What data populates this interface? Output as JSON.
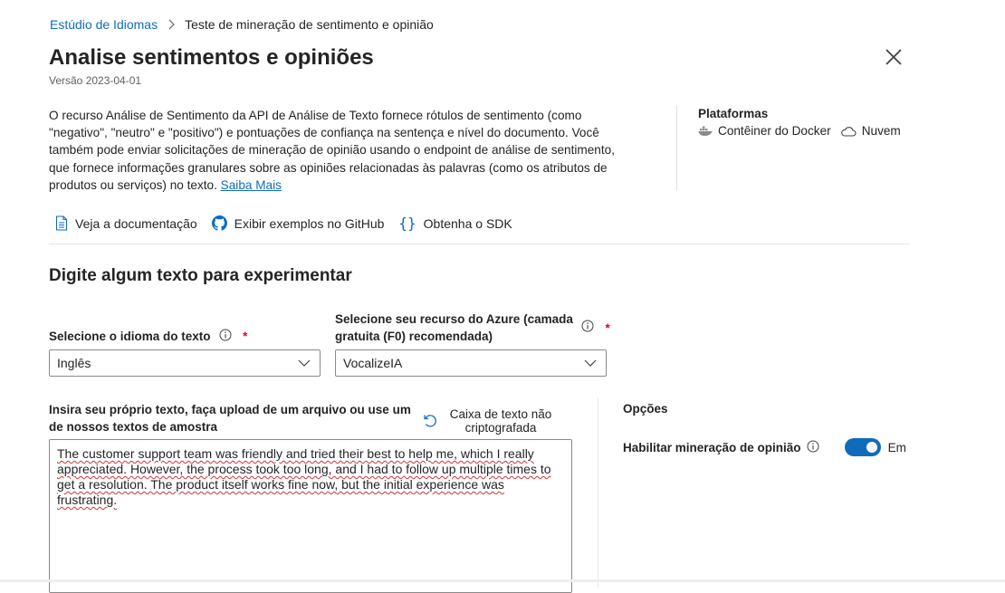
{
  "breadcrumb": {
    "root": "Estúdio de Idiomas",
    "current": "Teste de mineração de sentimento e opinião"
  },
  "header": {
    "title": "Analise sentimentos e opiniões",
    "version": "Versão 2023-04-01"
  },
  "description": {
    "text": "O recurso Análise de Sentimento da API de Análise de Texto fornece rótulos de sentimento (como \"negativo\", \"neutro\" e \"positivo\") e pontuações de confiança na sentença e nível do documento. Você também pode enviar solicitações de mineração de opinião usando o endpoint de análise de sentimento, que fornece informações granulares sobre as opiniões relacionadas às palavras (como os atributos de produtos ou serviços) no texto.",
    "learn_more": "Saiba Mais"
  },
  "platforms": {
    "title": "Plataformas",
    "docker": "Contêiner do Docker",
    "cloud": "Nuvem"
  },
  "links": {
    "docs": "Veja a documentação",
    "github": "Exibir exemplos no GitHub",
    "sdk": "Obtenha o SDK"
  },
  "section": {
    "title": "Digite algum texto para experimentar"
  },
  "form": {
    "language_label": "Selecione o idioma do texto",
    "language_value": "Inglês",
    "resource_label_line1": "Selecione seu recurso do Azure (camada",
    "resource_label_line2": "gratuita (F0) recomendada)",
    "resource_value": "VocalizeIA",
    "required_mark": "*",
    "text_label_line1": "Insira seu próprio texto, faça upload de um arquivo ou use um",
    "text_label_line2": "de nossos textos de amostra",
    "clear_line1": "Caixa de texto não",
    "clear_line2": "criptografada",
    "text_value": "The customer support team was friendly and tried their best to help me, which I really appreciated. However, the process took too long, and I had to follow up multiple times to get a resolution. The product itself works fine now, but the initial experience was frustrating."
  },
  "options": {
    "title": "Opções",
    "opinion_mining_label": "Habilitar mineração de opinião",
    "toggle_state": "Em",
    "toggle_on": true
  },
  "colors": {
    "accent": "#0f6cbd",
    "required": "#c50f1f"
  }
}
